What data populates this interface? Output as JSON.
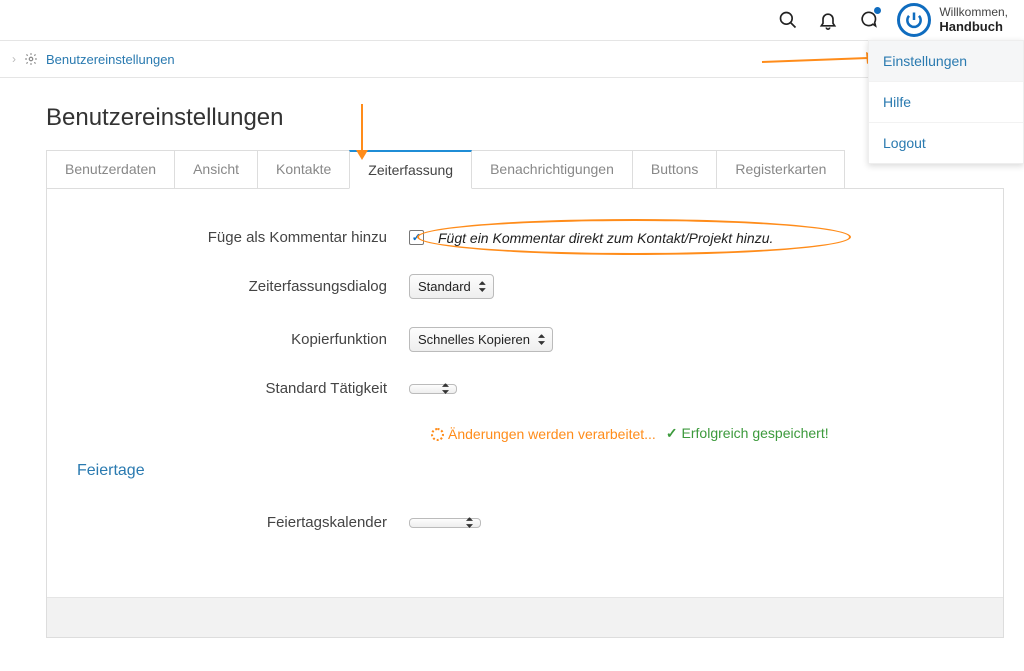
{
  "topbar": {
    "welcome_prefix": "Willkommen,",
    "username": "Handbuch"
  },
  "breadcrumb": {
    "link": "Benutzereinstellungen"
  },
  "page_title": "Benutzereinstellungen",
  "tabs": [
    {
      "label": "Benutzerdaten"
    },
    {
      "label": "Ansicht"
    },
    {
      "label": "Kontakte"
    },
    {
      "label": "Zeiterfassung"
    },
    {
      "label": "Benachrichtigungen"
    },
    {
      "label": "Buttons"
    },
    {
      "label": "Registerkarten"
    }
  ],
  "active_tab_index": 3,
  "form": {
    "add_comment_label": "Füge als Kommentar hinzu",
    "add_comment_checked": true,
    "add_comment_help": "Fügt ein Kommentar direkt zum Kontakt/Projekt hinzu.",
    "dialog_label": "Zeiterfassungsdialog",
    "dialog_value": "Standard",
    "copy_label": "Kopierfunktion",
    "copy_value": "Schnelles Kopieren",
    "default_activity_label": "Standard Tätigkeit",
    "default_activity_value": "",
    "holidays_heading": "Feiertage",
    "holiday_calendar_label": "Feiertagskalender",
    "holiday_calendar_value": ""
  },
  "status": {
    "processing": "Änderungen werden verarbeitet...",
    "success": "Erfolgreich gespeichert!"
  },
  "dropdown": {
    "items": [
      {
        "label": "Einstellungen"
      },
      {
        "label": "Hilfe"
      },
      {
        "label": "Logout"
      }
    ]
  }
}
